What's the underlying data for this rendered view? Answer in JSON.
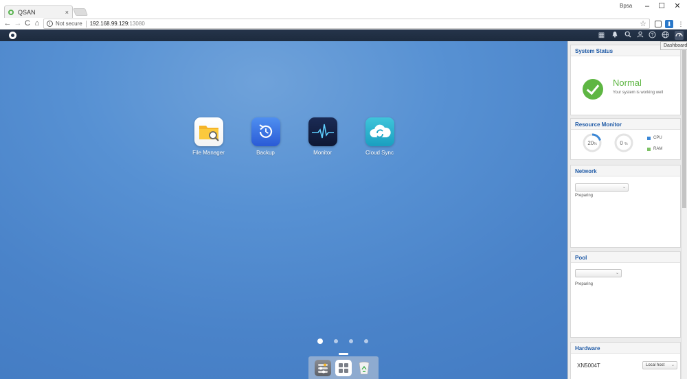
{
  "browser": {
    "tab_title": "QSAN",
    "tab_close": "×",
    "user": "Bpsa",
    "win_min": "–",
    "win_max": "☐",
    "win_close": "✕",
    "nav_back": "←",
    "nav_forward": "→",
    "nav_reload": "C",
    "nav_home": "⌂",
    "security": "Not secure",
    "url_host": "192.168.99.129:",
    "url_port": "13080",
    "star": "☆",
    "menu": "⋮"
  },
  "appbar": {
    "tooltip": "Dashboard",
    "icons": [
      "apps-icon",
      "bell-icon",
      "search-icon",
      "user-icon",
      "help-icon",
      "globe-icon",
      "dashboard-icon"
    ]
  },
  "desktop": {
    "apps": [
      {
        "name": "file-manager",
        "label": "File Manager"
      },
      {
        "name": "backup",
        "label": "Backup"
      },
      {
        "name": "monitor",
        "label": "Monitor"
      },
      {
        "name": "cloud-sync",
        "label": "Cloud Sync"
      }
    ],
    "pages": 4,
    "current_page": 1
  },
  "dashboard": {
    "system_status": {
      "title": "System Status",
      "state": "Normal",
      "message": "Your system is working well",
      "color": "#5eb643"
    },
    "resource_monitor": {
      "title": "Resource Monitor",
      "cpu_value": "20",
      "cpu_fraction": 0.2,
      "ram_value": "0",
      "ram_fraction": 0,
      "unit": "%",
      "cpu_label": "CPU",
      "ram_label": "RAM",
      "cpu_color": "#3b87d6",
      "ram_color": "#7cc164"
    },
    "network": {
      "title": "Network",
      "selected": "",
      "status": "Preparing"
    },
    "pool": {
      "title": "Pool",
      "selected": "",
      "status": "Preparing"
    },
    "hardware": {
      "title": "Hardware",
      "model": "XN5004T",
      "host": "Local host"
    }
  }
}
